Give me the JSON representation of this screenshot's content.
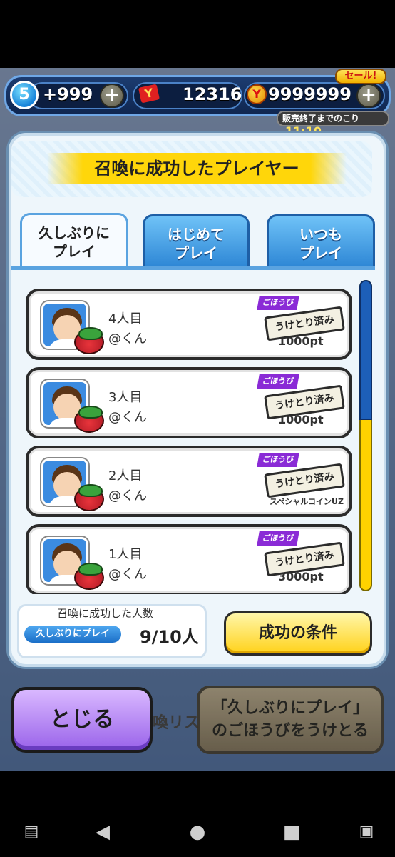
{
  "hud": {
    "stamina_level": "5",
    "stamina_value": "+999",
    "ticket_count": "12316",
    "coin_count": "9999999",
    "plus_label": "+",
    "sale_badge": "セール!",
    "sale_timer_label": "販売終了までのこり",
    "sale_timer_value": "11:10"
  },
  "dialog": {
    "title": "召喚に成功したプレイヤー",
    "tabs": [
      {
        "label": "久しぶりに\nプレイ",
        "active": true
      },
      {
        "label": "はじめて\nプレイ",
        "active": false
      },
      {
        "label": "いつも\nプレイ",
        "active": false
      }
    ],
    "rows": [
      {
        "count": "4人目",
        "name": "@くん",
        "reward": "1000pt",
        "reward_label": "ごほうび",
        "status": "うけとり済み"
      },
      {
        "count": "3人目",
        "name": "@くん",
        "reward": "1000pt",
        "reward_label": "ごほうび",
        "status": "うけとり済み"
      },
      {
        "count": "2人目",
        "name": "@くん",
        "reward": "スペシャルコインUZ",
        "reward_label": "ごほうび",
        "status": "うけとり済み"
      },
      {
        "count": "1人目",
        "name": "@くん",
        "reward": "3000pt",
        "reward_label": "ごほうび",
        "status": "うけとり済み"
      }
    ],
    "success_count_label": "召喚に成功した人数",
    "success_count_tag": "久しぶりにプレイ",
    "success_count_value": "9/10人",
    "condition_button": "成功の条件"
  },
  "bottom": {
    "close_button": "とじる",
    "behind_text": "喚リス",
    "claim_button": "「久しぶりにプレイ」\nのごほうびをうけとる"
  },
  "colors": {
    "accent_yellow": "#ffd21a",
    "accent_blue": "#2f88d6",
    "close_purple": "#9a63ea"
  }
}
